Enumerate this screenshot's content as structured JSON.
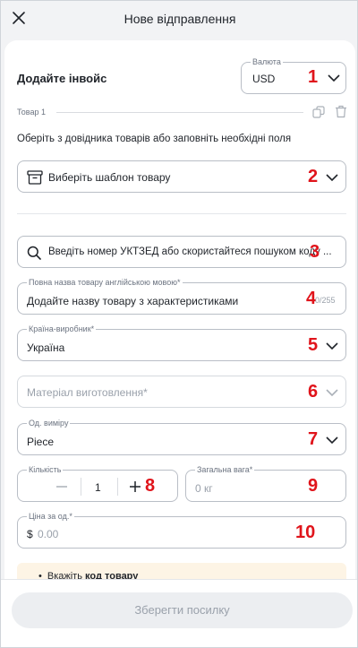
{
  "header": {
    "title": "Нове відправлення"
  },
  "invoice": {
    "title": "Додайте інвойс",
    "currency_label": "Валюта",
    "currency_value": "USD"
  },
  "item": {
    "label": "Товар 1",
    "instruction": "Оберіть з довідника товарів або заповніть необхідні поля",
    "template_placeholder": "Виберіть шаблон товару",
    "search_placeholder": "Введіть номер УКТЗЕД або скористайтеся пошуком коду ...",
    "name_label": "Повна назва товару англійською мовою*",
    "name_placeholder": "Додайте назву товару з характеристиками",
    "name_counter": "0/255",
    "country_label": "Країна-виробник*",
    "country_value": "Україна",
    "material_placeholder": "Матеріал виготовлення*",
    "unit_label": "Од. виміру",
    "unit_value": "Piece",
    "quantity_label": "Кількість",
    "quantity_value": "1",
    "weight_label": "Загальна вага*",
    "weight_placeholder": "0 кг",
    "price_label": "Ціна за од.*",
    "price_currency": "$",
    "price_placeholder": "0.00"
  },
  "info": {
    "bullet": "•",
    "text_prefix": "Вкажіть",
    "text_bold": "код товару"
  },
  "footer": {
    "save_label": "Зберегти посилку"
  },
  "annotations": [
    "1",
    "2",
    "3",
    "4",
    "5",
    "6",
    "7",
    "8",
    "9",
    "10"
  ],
  "colors": {
    "annotation": "#e0141b",
    "border": "#b9bec6",
    "info_bg": "#fdf4e5",
    "button_bg": "#eceef1"
  }
}
